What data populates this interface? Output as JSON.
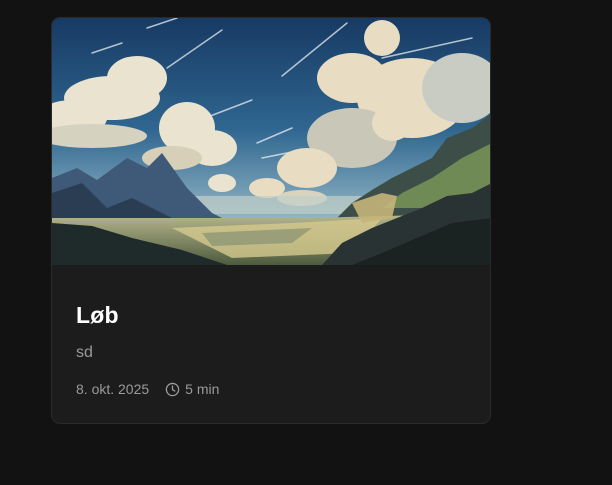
{
  "card": {
    "title": "Løb",
    "subtitle": "sd",
    "date": "8. okt. 2025",
    "read_time": "5 min",
    "cover_icon": "landscape-illustration",
    "time_icon": "clock-icon"
  },
  "colors": {
    "page_background": "#121212",
    "card_background": "#1c1c1c",
    "title": "#ffffff",
    "muted_text": "#9a9a9a"
  }
}
